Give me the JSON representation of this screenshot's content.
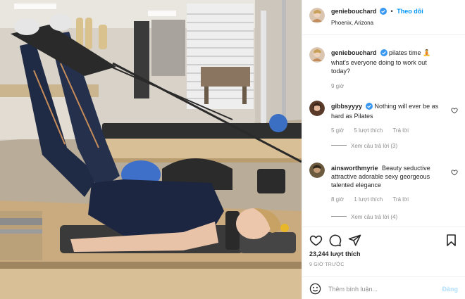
{
  "post": {
    "username": "geniebouchard",
    "follow_label": "Theo dõi",
    "location": "Phoenix, Arizona",
    "caption_emoji": "🧘",
    "caption": "pilates time",
    "caption_line2": "what's everyone doing to work out today?",
    "caption_time": "9 giờ"
  },
  "comments": [
    {
      "username": "gibbsyyyy",
      "text": "Nothing will ever be as hard as Pilates",
      "time": "5 giờ",
      "likes": "5 lượt thích",
      "reply": "Trả lời",
      "view_replies": "Xem câu trả lời (3)",
      "avatar_color": "#5a3b2a"
    },
    {
      "username": "ainsworthmyrie",
      "text": "Beauty seductive attractive adorable sexy georgeous talented elegance",
      "time": "8 giờ",
      "likes": "1 lượt thích",
      "reply": "Trả lời",
      "view_replies": "Xem câu trả lời (4)",
      "avatar_color": "#6b5a3e"
    }
  ],
  "actions": {
    "like_count": "23,244 lượt thích",
    "time_ago": "9 GIỜ TRƯỚC",
    "comment_placeholder": "Thêm bình luận...",
    "post_label": "Đăng"
  },
  "icons": [
    "verified-badge-icon",
    "heart-icon",
    "comment-icon",
    "share-icon",
    "bookmark-icon",
    "emoji-icon"
  ],
  "colors": {
    "accent": "#0095f6",
    "muted": "#8e8e8e",
    "text": "#262626",
    "post_disabled": "#b2dffc"
  }
}
